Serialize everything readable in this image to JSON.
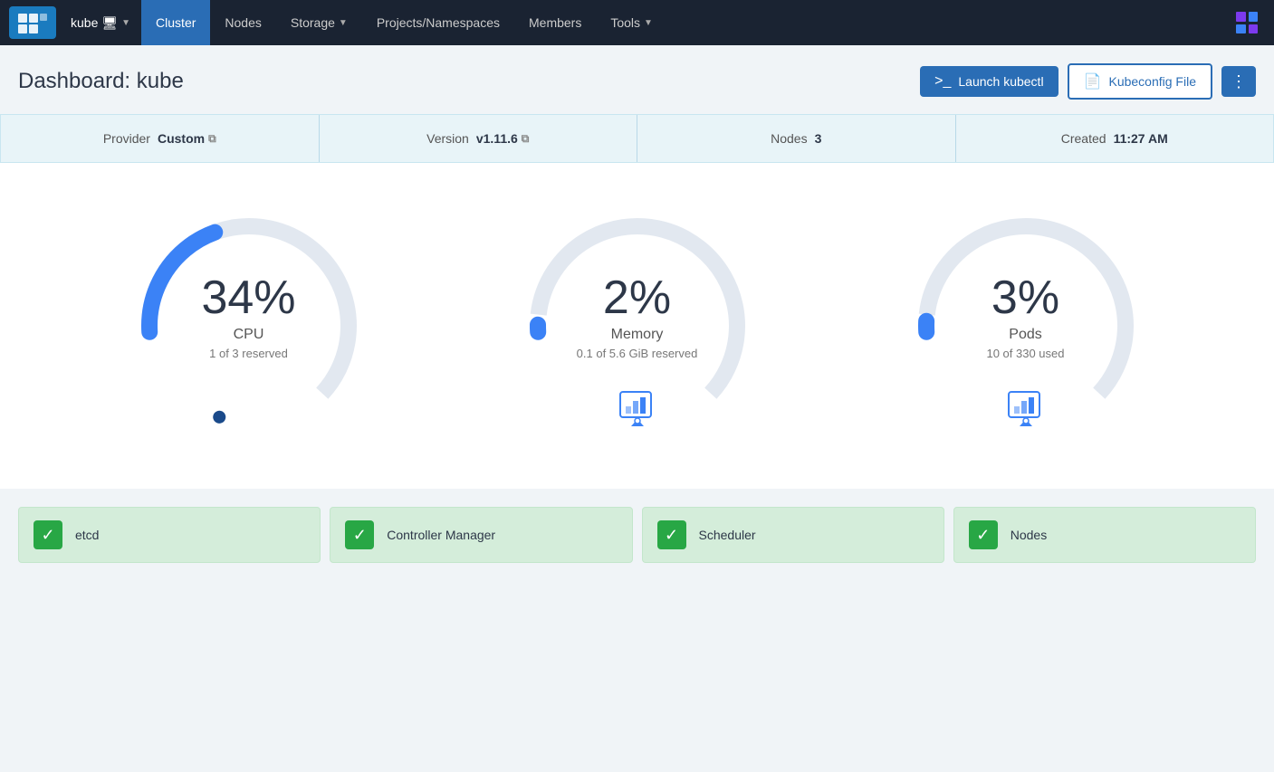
{
  "navbar": {
    "logo_alt": "Rancher",
    "kube_label": "kube",
    "nav_items": [
      {
        "id": "cluster",
        "label": "Cluster",
        "active": true,
        "dropdown": false
      },
      {
        "id": "nodes",
        "label": "Nodes",
        "active": false,
        "dropdown": false
      },
      {
        "id": "storage",
        "label": "Storage",
        "active": false,
        "dropdown": true
      },
      {
        "id": "projects",
        "label": "Projects/Namespaces",
        "active": false,
        "dropdown": false
      },
      {
        "id": "members",
        "label": "Members",
        "active": false,
        "dropdown": false
      },
      {
        "id": "tools",
        "label": "Tools",
        "active": false,
        "dropdown": true
      }
    ]
  },
  "header": {
    "title": "Dashboard: kube",
    "launch_kubectl": "Launch kubectl",
    "kubeconfig_file": "Kubeconfig File",
    "more_options": "⋮"
  },
  "info_bar": {
    "provider_label": "Provider",
    "provider_value": "Custom",
    "version_label": "Version",
    "version_value": "v1.11.6",
    "nodes_label": "Nodes",
    "nodes_value": "3",
    "created_label": "Created",
    "created_value": "11:27 AM"
  },
  "gauges": [
    {
      "id": "cpu",
      "percent": "34%",
      "label": "CPU",
      "sub": "1 of 3 reserved",
      "value": 34,
      "color": "#3b82f6",
      "track_color": "#e2e8f0",
      "has_bottom_icon": false
    },
    {
      "id": "memory",
      "percent": "2%",
      "label": "Memory",
      "sub": "0.1 of 5.6 GiB reserved",
      "value": 2,
      "color": "#3b82f6",
      "track_color": "#e2e8f0",
      "has_bottom_icon": true
    },
    {
      "id": "pods",
      "percent": "3%",
      "label": "Pods",
      "sub": "10 of 330 used",
      "value": 3,
      "color": "#3b82f6",
      "track_color": "#e2e8f0",
      "has_bottom_icon": true
    }
  ],
  "status_items": [
    {
      "id": "etcd",
      "label": "etcd",
      "status": "ok"
    },
    {
      "id": "controller-manager",
      "label": "Controller Manager",
      "status": "ok"
    },
    {
      "id": "scheduler",
      "label": "Scheduler",
      "status": "ok"
    },
    {
      "id": "nodes",
      "label": "Nodes",
      "status": "ok"
    }
  ]
}
